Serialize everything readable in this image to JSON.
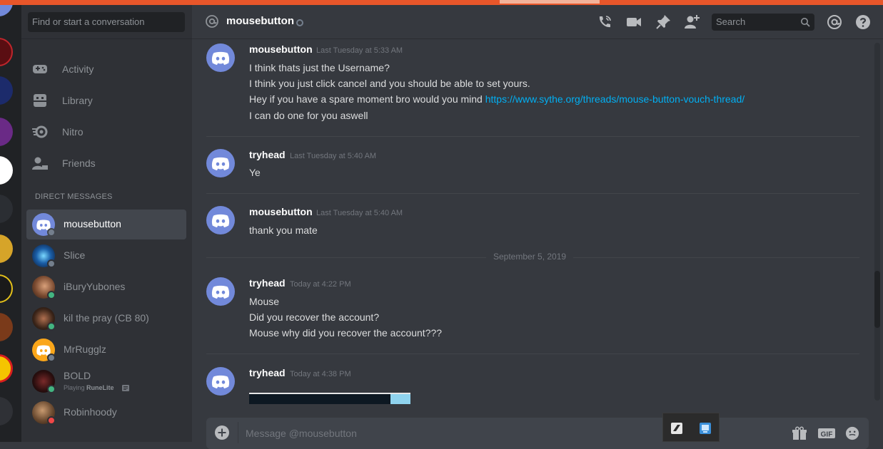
{
  "colors": {
    "accent": "#7289da",
    "link": "#00b0f4",
    "online": "#43b581",
    "offline": "#747f8d",
    "dnd": "#f04747",
    "window_bar": "#e8562a"
  },
  "sidebar": {
    "find_placeholder": "Find or start a conversation",
    "nav": [
      {
        "label": "Activity",
        "icon": "gamepad-icon"
      },
      {
        "label": "Library",
        "icon": "library-icon"
      },
      {
        "label": "Nitro",
        "icon": "nitro-icon"
      },
      {
        "label": "Friends",
        "icon": "friends-icon"
      }
    ],
    "dm_header": "DIRECT MESSAGES",
    "dms": [
      {
        "name": "mousebutton",
        "status": "offline",
        "active": true
      },
      {
        "name": "Slice",
        "status": "offline"
      },
      {
        "name": "iBuryYubones",
        "status": "online"
      },
      {
        "name": "kil the pray (CB 80)",
        "status": "online"
      },
      {
        "name": "MrRugglz",
        "status": "offline"
      },
      {
        "name": "BOLD",
        "status": "online",
        "activity_prefix": "Playing",
        "activity_game": "RuneLite"
      },
      {
        "name": "Robinhoody",
        "status": "dnd"
      }
    ]
  },
  "header": {
    "channel_name": "mousebutton",
    "search_placeholder": "Search",
    "icons": [
      "call-icon",
      "video-icon",
      "pin-icon",
      "add-friend-icon",
      "mention-icon",
      "help-icon"
    ]
  },
  "messages": [
    {
      "author": "mousebutton",
      "timestamp": "Last Tuesday at 5:33 AM",
      "lines": [
        "I think thats just the Username?",
        "I think you just click cancel and you should be able to set yours.",
        "Hey if you have a spare moment bro would you mind",
        "I can do one for you aswell"
      ],
      "link": "https://www.sythe.org/threads/mouse-button-vouch-thread/"
    },
    {
      "author": "tryhead",
      "timestamp": "Last Tuesday at 5:40 AM",
      "lines": [
        "Ye"
      ]
    },
    {
      "author": "mousebutton",
      "timestamp": "Last Tuesday at 5:40 AM",
      "lines": [
        "thank you mate"
      ]
    },
    {
      "author": "tryhead",
      "timestamp": "Today at 4:22 PM",
      "lines": [
        "Mouse",
        "Did you recover the account?",
        "Mouse why did you recover the account???"
      ]
    },
    {
      "author": "tryhead",
      "timestamp": "Today at 4:38 PM",
      "lines": []
    }
  ],
  "date_divider": "September 5, 2019",
  "composer": {
    "placeholder": "Message @mousebutton",
    "icons": [
      "add-attachment-icon",
      "gift-icon",
      "gif-icon",
      "emoji-icon"
    ]
  }
}
